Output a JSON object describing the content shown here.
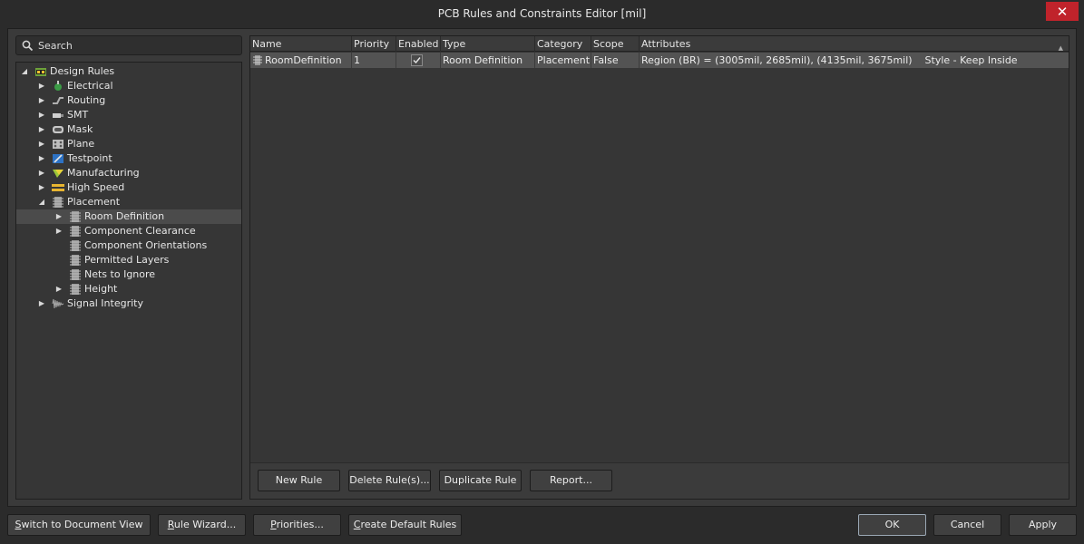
{
  "window": {
    "title": "PCB Rules and Constraints Editor [mil]"
  },
  "search": {
    "placeholder": "Search"
  },
  "tree": {
    "root": "Design Rules",
    "categories": [
      {
        "label": "Electrical"
      },
      {
        "label": "Routing"
      },
      {
        "label": "SMT"
      },
      {
        "label": "Mask"
      },
      {
        "label": "Plane"
      },
      {
        "label": "Testpoint"
      },
      {
        "label": "Manufacturing"
      },
      {
        "label": "High Speed"
      },
      {
        "label": "Placement"
      },
      {
        "label": "Signal Integrity"
      }
    ],
    "placement_children": [
      {
        "label": "Room Definition"
      },
      {
        "label": "Component Clearance"
      },
      {
        "label": "Component Orientations"
      },
      {
        "label": "Permitted Layers"
      },
      {
        "label": "Nets to Ignore"
      },
      {
        "label": "Height"
      }
    ]
  },
  "grid": {
    "columns": [
      "Name",
      "Priority",
      "Enabled",
      "Type",
      "Category",
      "Scope",
      "Attributes"
    ],
    "rows": [
      {
        "name": "RoomDefinition",
        "priority": "1",
        "enabled": true,
        "type": "Room Definition",
        "category": "Placement",
        "scope": "False",
        "attributes": "Region (BR) = (3005mil, 2685mil), (4135mil, 3675mil)    Style - Keep Inside"
      }
    ],
    "buttons": {
      "new_rule": "New Rule",
      "delete_rule": "Delete Rule(s)...",
      "duplicate_rule": "Duplicate Rule",
      "report": "Report..."
    }
  },
  "footer": {
    "switch_doc_prefix": "S",
    "switch_doc_rest": "witch to Document View",
    "rule_wizard_prefix": "R",
    "rule_wizard_rest": "ule Wizard...",
    "priorities_prefix": "P",
    "priorities_rest": "riorities...",
    "create_default_prefix": "C",
    "create_default_rest": "reate Default Rules",
    "ok": "OK",
    "cancel": "Cancel",
    "apply": "Apply"
  },
  "colors": {
    "accent_close": "#c0232b",
    "background": "#3a3a3a",
    "selection": "#535353"
  }
}
